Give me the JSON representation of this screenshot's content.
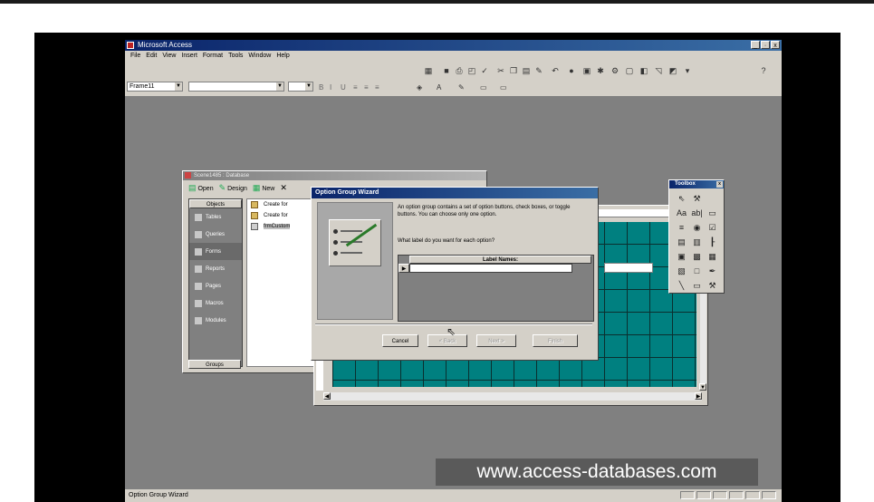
{
  "app": {
    "title": "Microsoft Access",
    "window_controls": [
      "_",
      "·",
      "x"
    ],
    "menu": [
      "File",
      "Edit",
      "View",
      "Insert",
      "Format",
      "Tools",
      "Window",
      "Help"
    ],
    "object_combo": "Frame11",
    "status_text": "Option Group Wizard"
  },
  "database_window": {
    "title": "Scene1485 : Database",
    "toolbar": {
      "open": "Open",
      "design": "Design",
      "new": "New",
      "delete_icon": "✕"
    },
    "objects_header": "Objects",
    "objects": [
      "Tables",
      "Queries",
      "Forms",
      "Reports",
      "Pages",
      "Macros",
      "Modules"
    ],
    "selected_object": "Forms",
    "groups_label": "Groups",
    "items": [
      "Create for",
      "Create for",
      "frmCustom"
    ]
  },
  "wizard": {
    "title": "Option Group Wizard",
    "description": "An option group contains a set of option buttons, check boxes, or toggle buttons. You can choose only one option.",
    "question": "What label do you want for each option?",
    "column_header": "Label Names:",
    "row_selector": "▶",
    "buttons": {
      "cancel": "Cancel",
      "back": "< Back",
      "next": "Next >",
      "finish": "Finish"
    }
  },
  "toolbox": {
    "title": "Toolbox",
    "close": "x",
    "tool_icons": [
      "⇖",
      "⚒",
      "",
      "Aa",
      "ab|",
      "▭",
      "≡",
      "◉",
      "☑",
      "▤",
      "▥",
      "┠",
      "▣",
      "▩",
      "▦",
      "▧",
      "□",
      "✒",
      "╲",
      "▭",
      "⚒"
    ]
  },
  "watermark": "www.access-databases.com",
  "colors": {
    "form_grid": "#008080",
    "workspace": "#808080",
    "title_bar": "#0a246a"
  }
}
